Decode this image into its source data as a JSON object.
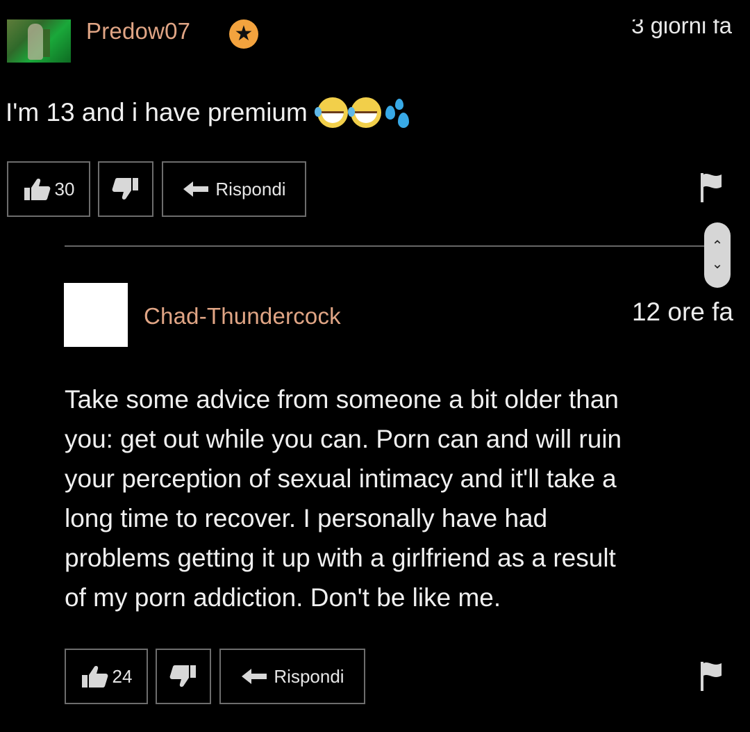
{
  "comments": [
    {
      "username": "Predow07",
      "badge_icon": "star-icon",
      "badge_color": "#f3a33e",
      "time": "3 giorni fa",
      "text": "I'm 13 and i have premium",
      "emojis": [
        "face-with-tears-of-joy",
        "face-with-tears-of-joy",
        "sweat-droplets"
      ],
      "likes": "30",
      "reply_label": "Rispondi"
    },
    {
      "username": "Chad-Thundercock",
      "time": "12 ore fa",
      "text_lines": [
        "Take some advice from someone a bit older than",
        "you: get out while you can. Porn can and will ruin",
        "your perception of sexual intimacy and it'll take a",
        "long time to recover. I personally have had",
        "problems getting it up with a girlfriend as a result",
        "of my porn addiction. Don't be like me."
      ],
      "likes": "24",
      "reply_label": "Rispondi"
    }
  ],
  "colors": {
    "background": "#000000",
    "username": "#e0a585",
    "border": "#6d6d6d"
  },
  "icons": {
    "like": "thumbs-up-icon",
    "dislike": "thumbs-down-icon",
    "reply": "reply-arrow-icon",
    "flag": "flag-icon",
    "scroll": "scroll-up-down-icon"
  }
}
